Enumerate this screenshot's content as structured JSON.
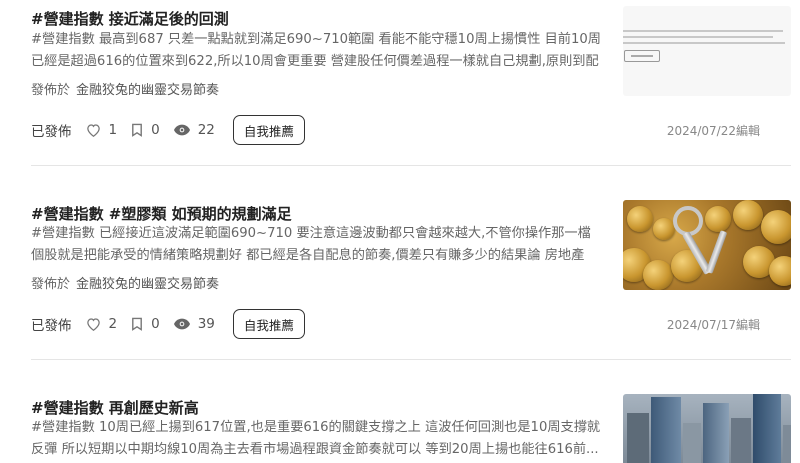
{
  "posts": [
    {
      "title": "#營建指數 接近滿足後的回測",
      "excerpt": "#營建指數 最高到687 只差一點點就到滿足690~710範圍 看能不能守穩10周上揚慣性 目前10周已經是超過616的位置來到622,所以10周會更重要 營建股任何價差過程一樣就自己規劃,原則到配息...",
      "publisher_label": "發佈於",
      "publisher_name": "金融狡兔的幽靈交易節奏",
      "status": "已發佈",
      "likes": "1",
      "bookmarks": "0",
      "views": "22",
      "promote_label": "自我推薦",
      "date": "2024/07/22編輯",
      "thumbnail": "document-screenshot"
    },
    {
      "title": "#營建指數 #塑膠類 如預期的規劃滿足",
      "excerpt": "#營建指數 已經接近這波滿足範圍690~710 要注意這邊波動都只會越來越大,不管你操作那一檔個股就是把能承受的情緒策略規劃好 都已經是各自配息的節奏,價差只有賺多少的結果論 房地產題...",
      "publisher_label": "發佈於",
      "publisher_name": "金融狡兔的幽靈交易節奏",
      "status": "已發佈",
      "likes": "2",
      "bookmarks": "0",
      "views": "39",
      "promote_label": "自我推薦",
      "date": "2024/07/17編輯",
      "thumbnail": "gold-coins-and-keys"
    },
    {
      "title": "#營建指數 再創歷史新高",
      "excerpt": "#營建指數 10周已經上揚到617位置,也是重要616的關鍵支撐之上 這波任何回測也是10周支撐就反彈 所以短期以中期均線10周為主去看市場過程跟資金節奏就可以 等到20周上揚也能往616前...",
      "thumbnail": "city-skyline"
    }
  ],
  "icons": {
    "like": "heart-outline-icon",
    "bookmark": "bookmark-outline-icon",
    "views": "eye-icon"
  },
  "colors": {
    "title": "#222222",
    "muted": "#666666",
    "divider": "#e5e5e5"
  }
}
